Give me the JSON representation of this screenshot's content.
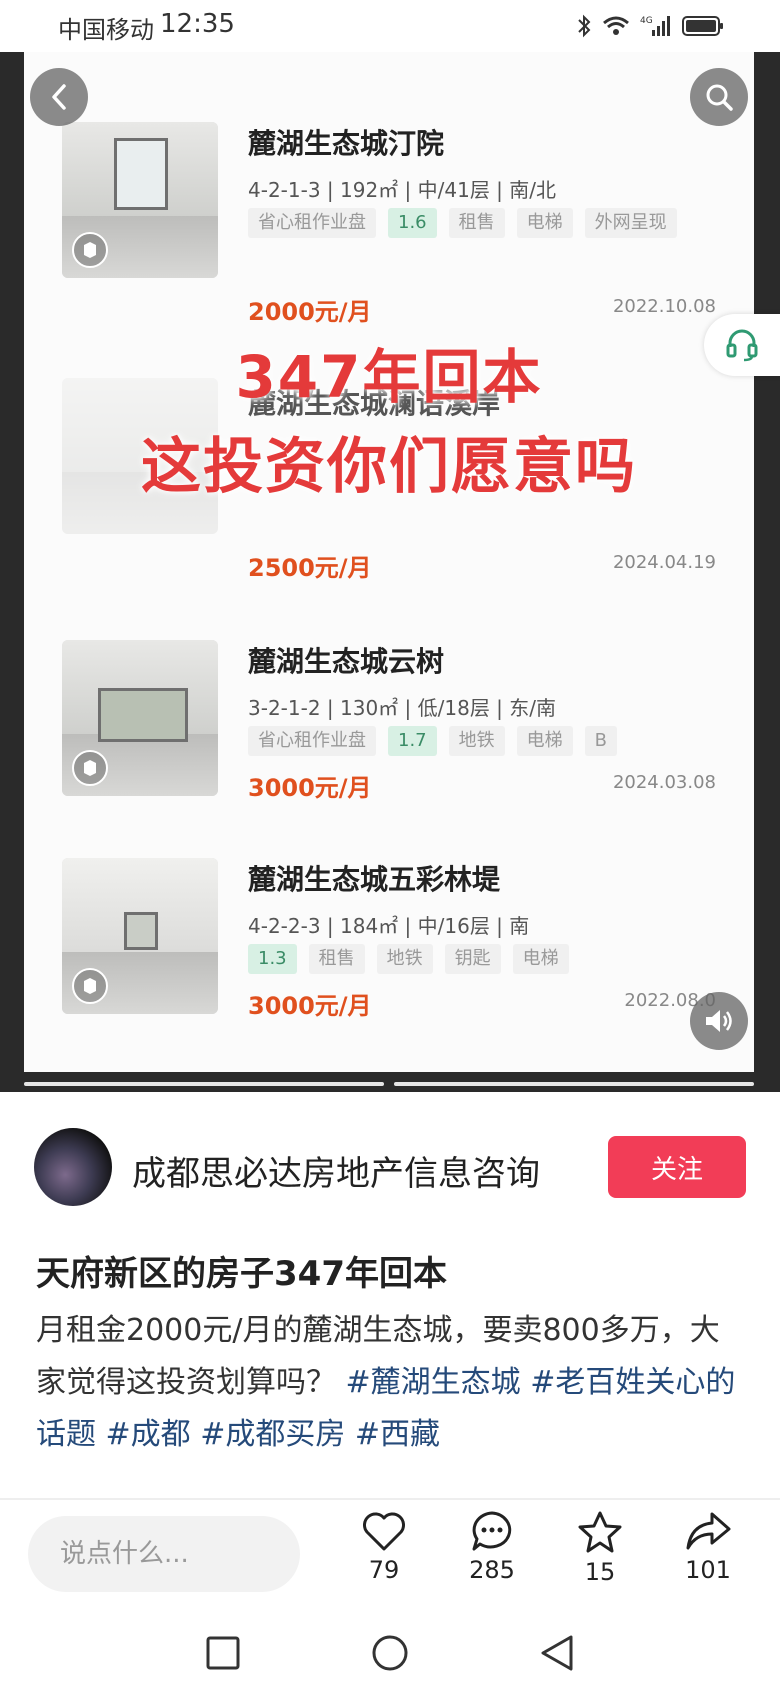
{
  "status_bar": {
    "carrier": "中国移动",
    "time": "12:35"
  },
  "listings": [
    {
      "title": "麓湖生态城汀院",
      "spec": "4-2-1-3 | 192㎡ | 中/41层 | 南/北",
      "tags": [
        "省心租作业盘",
        "1.6",
        "租售",
        "电梯",
        "外网呈现"
      ],
      "price": "2000元/月",
      "date": "2022.10.08"
    },
    {
      "title": "麓湖生态城澜语溪岸",
      "price": "2500元/月",
      "date": "2024.04.19"
    },
    {
      "title": "麓湖生态城云树",
      "spec": "3-2-1-2 | 130㎡ | 低/18层 | 东/南",
      "tags": [
        "省心租作业盘",
        "1.7",
        "地铁",
        "电梯",
        "B"
      ],
      "price": "3000元/月",
      "date": "2024.03.08"
    },
    {
      "title": "麓湖生态城五彩林堤",
      "spec": "4-2-2-3 | 184㎡ | 中/16层 | 南",
      "tags": [
        "1.3",
        "租售",
        "地铁",
        "钥匙",
        "电梯"
      ],
      "price": "3000元/月",
      "date": "2022.08.0"
    }
  ],
  "overlay": {
    "line1": "347年回本",
    "line2": "这投资你们愿意吗"
  },
  "author": {
    "name": "成都思必达房地产信息咨询",
    "follow_label": "关注"
  },
  "post": {
    "title": "天府新区的房子347年回本",
    "body_text": "月租金2000元/月的麓湖生态城，要卖800多万，大家觉得这投资划算吗？",
    "hashtags": [
      "#麓湖生态城",
      "#老百姓关心的话题",
      "#成都",
      "#成都买房",
      "#西藏"
    ]
  },
  "comment_input": {
    "placeholder": "说点什么..."
  },
  "actions": {
    "likes": "79",
    "comments": "285",
    "favorites": "15",
    "shares": "101"
  },
  "colors": {
    "follow": "#f23d57",
    "hashtag": "#254a7a",
    "price": "#e0501e",
    "overlay_text": "#e43a3a"
  }
}
